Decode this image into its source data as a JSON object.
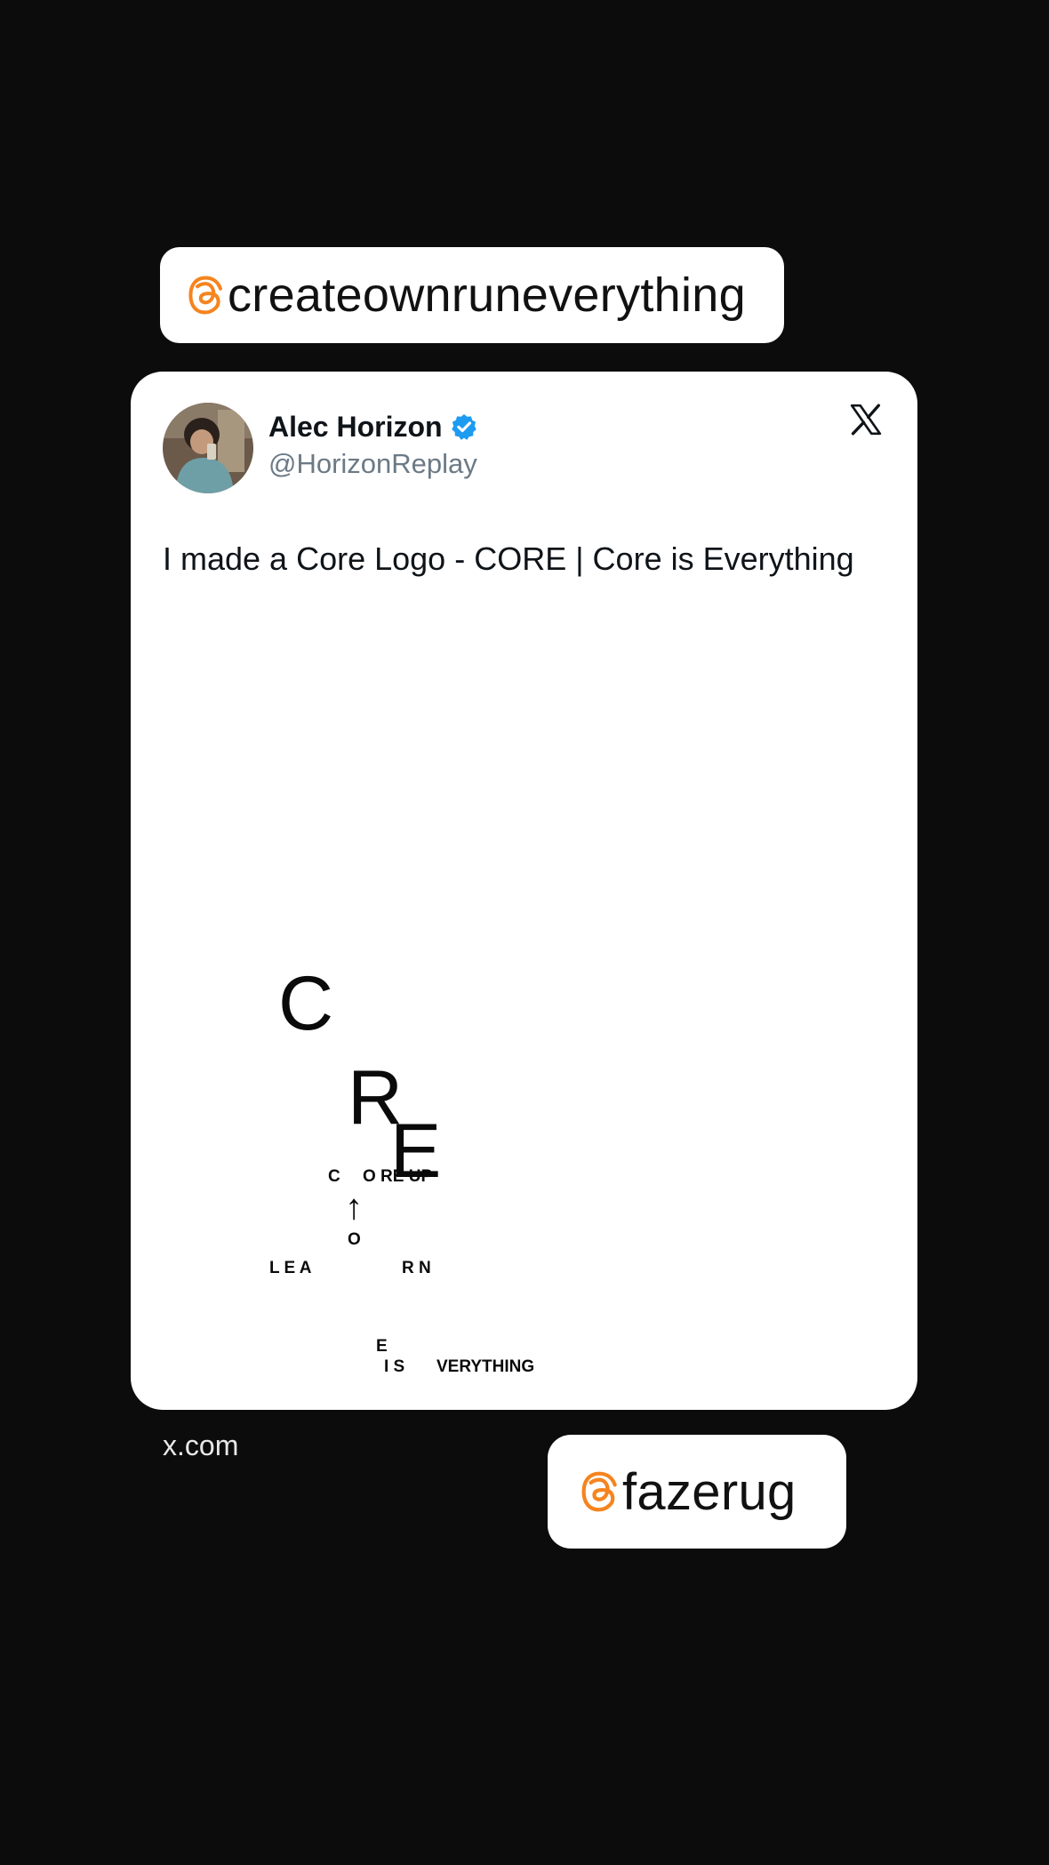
{
  "top_handle": {
    "text": "createownruneverything",
    "icon": "threads-icon",
    "icon_color": "#f5841f"
  },
  "post": {
    "author_name": "Alec Horizon",
    "verified_icon": "verified-badge-icon",
    "verified_color": "#1d9bf0",
    "author_handle": "@HorizonReplay",
    "platform_icon": "x-logo-icon",
    "text": "I made a Core Logo - CORE | Core is Everything",
    "logo": {
      "c": "C",
      "c_small": "C",
      "ore_up": "O RE  UP",
      "arrow": "↑",
      "o_small": "O",
      "learn": "L  E  A",
      "rn": "R   N",
      "r": "R",
      "e_small": "E",
      "e": "E",
      "is": "I  S",
      "verything": "VERYTHING"
    }
  },
  "source": "x.com",
  "bottom_handle": {
    "text": "fazerug",
    "icon": "threads-icon",
    "icon_color": "#f5841f"
  }
}
